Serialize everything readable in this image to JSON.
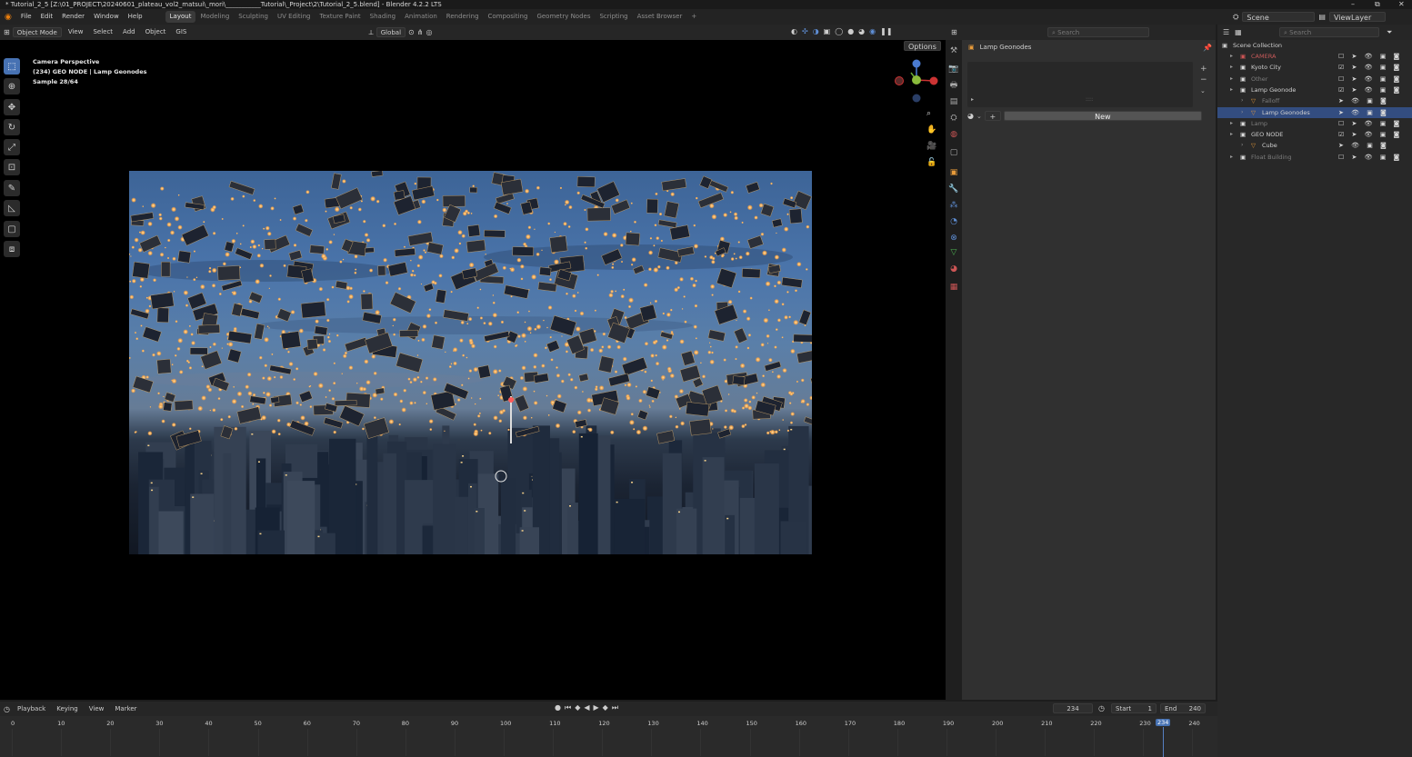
{
  "window_title": "* Tutorial_2_5 [Z:\\01_PROJECT\\20240601_plateau_vol2_matsui\\_mori\\___________Tutorial\\_Project\\2\\Tutorial_2_5.blend] - Blender 4.2.2 LTS",
  "window_controls": {
    "minimize": "–",
    "maximize": "⧉",
    "close": "✕"
  },
  "menu": [
    "File",
    "Edit",
    "Render",
    "Window",
    "Help"
  ],
  "workspaces": [
    "Layout",
    "Modeling",
    "Sculpting",
    "UV Editing",
    "Texture Paint",
    "Shading",
    "Animation",
    "Rendering",
    "Compositing",
    "Geometry Nodes",
    "Scripting",
    "Asset Browser"
  ],
  "workspace_add": "+",
  "scene": {
    "label": "Scene",
    "view_layer": "ViewLayer"
  },
  "viewport_header": {
    "mode": "Object Mode",
    "menus": [
      "View",
      "Select",
      "Add",
      "Object"
    ],
    "gis": "GIS",
    "transform": "Global",
    "options": "Options"
  },
  "viewport_overlay": {
    "line1": "Camera Perspective",
    "line2": "(234) GEO NODE | Lamp Geonodes",
    "line3": "Sample 28/64"
  },
  "properties": {
    "search_placeholder": "Search",
    "object_name": "Lamp Geonodes",
    "new_button": "New",
    "resize_handle": "::::",
    "add": "+",
    "remove": "−"
  },
  "outliner": {
    "search_placeholder": "Search",
    "root": "Scene Collection",
    "items": [
      {
        "name": "CAMERA",
        "indent": 0,
        "dim": true,
        "red": true,
        "icons": "☐ ➤ 👁 ▣ ◙"
      },
      {
        "name": "Kyoto City",
        "indent": 0,
        "dim": false,
        "icons": "☑ ➤ 👁 ▣ ◙"
      },
      {
        "name": "Other",
        "indent": 0,
        "dim": true,
        "icons": "☐ ➤ 👁 ▣ ◙"
      },
      {
        "name": "Lamp Geonode",
        "indent": 0,
        "dim": false,
        "icons": "☑ ➤ 👁 ▣ ◙"
      },
      {
        "name": "Falloff",
        "indent": 1,
        "dim": true,
        "icons": "  ➤ 👁 ▣ ◙"
      },
      {
        "name": "Lamp Geonodes",
        "indent": 1,
        "dim": false,
        "selected": true,
        "icons": "  ➤ 👁 ▣ ◙"
      },
      {
        "name": "Lamp",
        "indent": 0,
        "dim": true,
        "icons": "☐ ➤ 👁 ▣ ◙"
      },
      {
        "name": "GEO NODE",
        "indent": 0,
        "dim": false,
        "icons": "☑ ➤ 👁 ▣ ◙"
      },
      {
        "name": "Cube",
        "indent": 1,
        "dim": false,
        "icons": "  ➤ 👁 ▣ ◙"
      },
      {
        "name": "Float Building",
        "indent": 0,
        "dim": true,
        "icons": "☐ ➤ 👁 ▣ ◙"
      }
    ]
  },
  "timeline": {
    "menus": [
      "Playback",
      "Keying",
      "View",
      "Marker"
    ],
    "current_frame": "234",
    "start_label": "Start",
    "start": "1",
    "end_label": "End",
    "end": "240",
    "ticks": [
      "0",
      "10",
      "20",
      "30",
      "40",
      "50",
      "60",
      "70",
      "80",
      "90",
      "100",
      "110",
      "120",
      "130",
      "140",
      "150",
      "160",
      "170",
      "180",
      "190",
      "200",
      "210",
      "220",
      "230",
      "240"
    ],
    "playhead_label": "234"
  }
}
